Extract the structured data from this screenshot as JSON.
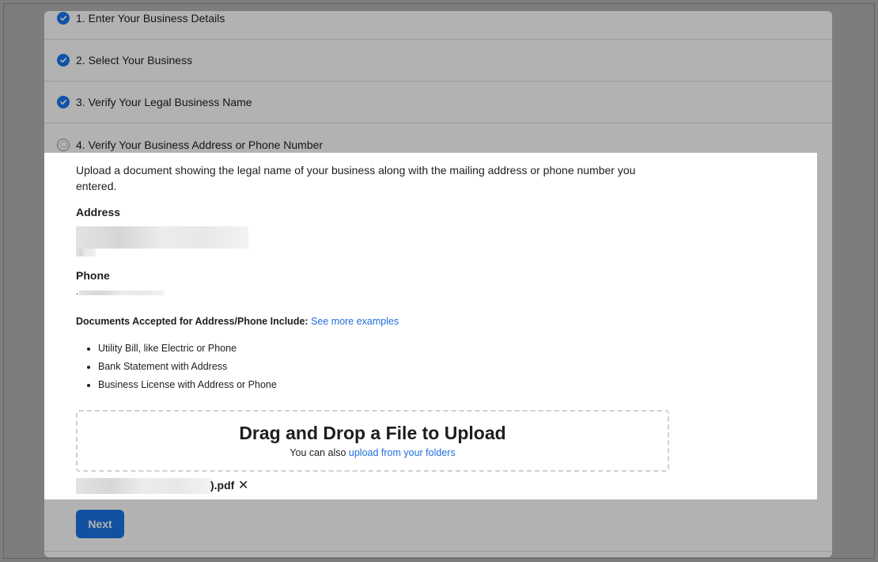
{
  "steps": [
    {
      "label": "1. Enter Your Business Details",
      "status": "done"
    },
    {
      "label": "2. Select Your Business",
      "status": "done"
    },
    {
      "label": "3. Verify Your Legal Business Name",
      "status": "done"
    },
    {
      "label": "4. Verify Your Business Address or Phone Number",
      "status": "current"
    }
  ],
  "upload": {
    "intro": "Upload a document showing the legal name of your business along with the mailing address or phone number you entered.",
    "address_label": "Address",
    "phone_label": "Phone",
    "phone_value": ".",
    "accepted_label": "Documents Accepted for Address/Phone Include:",
    "see_more": "See more examples",
    "accepted_docs": [
      "Utility Bill, like Electric or Phone",
      "Bank Statement with Address",
      "Business License with Address or Phone"
    ],
    "dropzone_title": "Drag and Drop a File to Upload",
    "dropzone_sub_prefix": "You can also",
    "dropzone_sub_link": "upload from your folders",
    "file_name_suffix": ").pdf",
    "remove_icon": "✕"
  },
  "actions": {
    "next_label": "Next"
  },
  "colors": {
    "accent": "#1b74e4",
    "link": "#216fdb",
    "check": "#1877f2"
  }
}
